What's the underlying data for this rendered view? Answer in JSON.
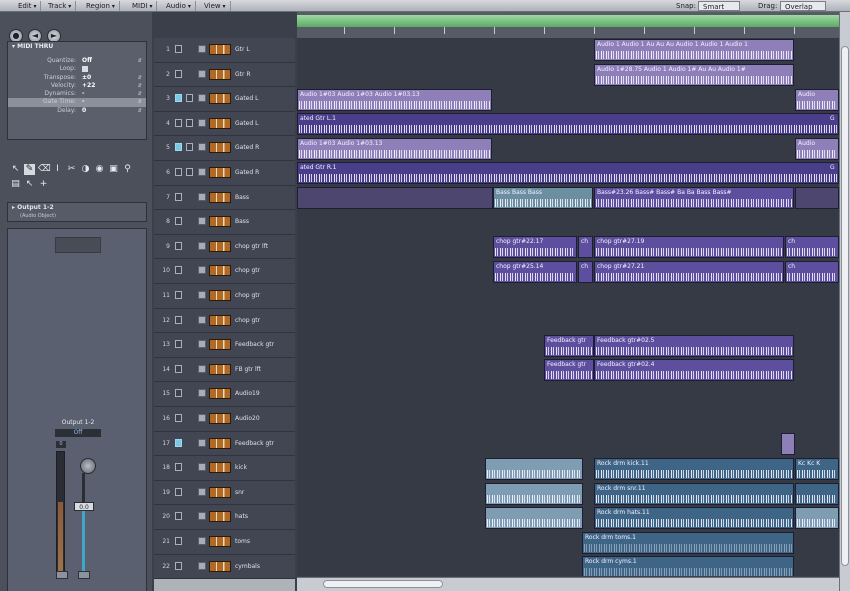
{
  "menubar": {
    "items": [
      "Edit",
      "Track",
      "Region",
      "MIDI",
      "Audio",
      "View"
    ],
    "snap_label": "Snap:",
    "snap_value": "Smart",
    "drag_label": "Drag:",
    "drag_value": "Overlap"
  },
  "inspector": {
    "region_panel_title": "MIDI THRU",
    "params": [
      {
        "label": "Quantize:",
        "value": "Off"
      },
      {
        "label": "Loop:",
        "value": ""
      },
      {
        "label": "Transpose:",
        "value": "±0"
      },
      {
        "label": "Velocity:",
        "value": "+22"
      },
      {
        "label": "Dynamics:",
        "value": "-"
      },
      {
        "label": "Gate Time:",
        "value": "-"
      },
      {
        "label": "Delay:",
        "value": "0"
      }
    ],
    "output_title": "Output 1-2",
    "output_sub": "(Audio Object)",
    "strip_name": "Output 1-2",
    "strip_auto": "Off",
    "pan_value": "0",
    "fader_value": "0.0"
  },
  "tracks": [
    {
      "num": "1",
      "name": "Gtr L"
    },
    {
      "num": "2",
      "name": "Gtr R"
    },
    {
      "num": "3",
      "name": "Gated L"
    },
    {
      "num": "4",
      "name": "Gated L"
    },
    {
      "num": "5",
      "name": "Gated R"
    },
    {
      "num": "6",
      "name": "Gated R"
    },
    {
      "num": "7",
      "name": "Bass"
    },
    {
      "num": "8",
      "name": "Bass"
    },
    {
      "num": "9",
      "name": "chop gtr lft"
    },
    {
      "num": "10",
      "name": "chop gtr"
    },
    {
      "num": "11",
      "name": "chop gtr"
    },
    {
      "num": "12",
      "name": "chop gtr"
    },
    {
      "num": "13",
      "name": "Feedback gtr"
    },
    {
      "num": "14",
      "name": "FB gtr lft"
    },
    {
      "num": "15",
      "name": "Audio19"
    },
    {
      "num": "16",
      "name": "Audio20"
    },
    {
      "num": "17",
      "name": "Feedback gtr"
    },
    {
      "num": "18",
      "name": "kick"
    },
    {
      "num": "19",
      "name": "snr"
    },
    {
      "num": "20",
      "name": "hats"
    },
    {
      "num": "21",
      "name": "toms"
    },
    {
      "num": "22",
      "name": "cymbals"
    }
  ],
  "regions": {
    "r1a": "Audio 1 Audio 1 Au Au Au Audio 1 Audio 1 Audio 1",
    "r2a": "Audio 1#28.75 Audio 1 Audio 1# Au Au  Audio 1#",
    "r3a": "Audio 1#03 Audio 1#03 Audio 1#03.13",
    "r3b": "Audio",
    "r4a": "ated Gtr L.1",
    "r4b": "G",
    "r5a": "Audio 1#03 Audio 1#03.13",
    "r5b": "Audio",
    "r6a": "ated Gtr R.1",
    "r6b": "G",
    "r7a": "Bass Bass Bass",
    "r7b": "Bass#23.26  Bass# Bass# Ba Ba  Bass Bass#",
    "r9a": "chop gtr#22.17",
    "r9b": "ch",
    "r9c": "chop gtr#27.19",
    "r9d": "ch",
    "r10a": "chop gtr#25.14",
    "r10b": "ch",
    "r10c": "chop gtr#27.21",
    "r10d": "ch",
    "r13a": "Feedback gtr",
    "r13b": "Feedback gtr#02.5",
    "r14a": "Feedback gtr",
    "r14b": "Feedback gtr#02.4",
    "r18a": "Rock drm kick.11",
    "r18b": "Kc Kc K",
    "r19a": "Rock drm snr.11",
    "r20a": "Rock drm hats.11",
    "r21a": "Rock drm toms.1",
    "r22a": "Rock drm cyms.1"
  }
}
